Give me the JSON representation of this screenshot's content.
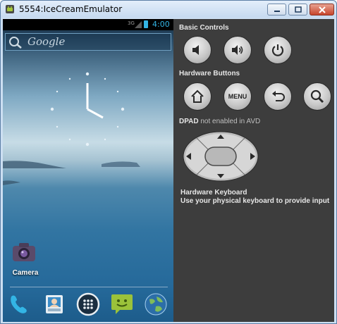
{
  "window": {
    "title": "5554:IceCreamEmulator",
    "controls": [
      "minimize",
      "maximize",
      "close"
    ]
  },
  "phone": {
    "status_bar": {
      "signal": "3G",
      "time": "4:00"
    },
    "search": {
      "placeholder": "Google"
    },
    "apps": [
      {
        "label": "Camera",
        "icon": "camera-icon"
      }
    ],
    "dock": [
      "phone-icon",
      "contacts-icon",
      "app-drawer-icon",
      "messaging-icon",
      "browser-icon"
    ]
  },
  "controls": {
    "basic_title": "Basic Controls",
    "basic_buttons": [
      "volume-down-icon",
      "volume-up-icon",
      "power-icon"
    ],
    "hardware_title": "Hardware Buttons",
    "hardware_buttons": [
      "home-icon",
      "menu",
      "back-icon",
      "search-icon"
    ],
    "menu_label": "MENU",
    "dpad_title": "DPAD",
    "dpad_note": "not enabled in AVD",
    "keyboard_title": "Hardware Keyboard",
    "keyboard_note": "Use your physical keyboard to provide input"
  },
  "colors": {
    "panel_bg": "#3d3d3d",
    "accent_blue": "#33b5e5"
  }
}
